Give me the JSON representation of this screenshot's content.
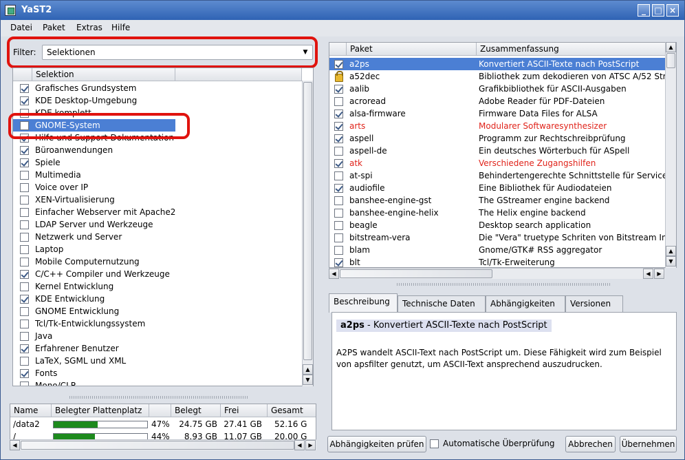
{
  "window": {
    "title": "YaST2",
    "minimize": "_",
    "maximize": "□",
    "close": "×"
  },
  "menu": [
    "Datei",
    "Paket",
    "Extras",
    "Hilfe"
  ],
  "filter": {
    "label": "Filter:",
    "value": "Selektionen"
  },
  "selection_list": {
    "header": "Selektion",
    "items": [
      {
        "label": "Grafisches Grundsystem",
        "checked": true
      },
      {
        "label": "KDE Desktop-Umgebung",
        "checked": true
      },
      {
        "label": "KDE komplett",
        "checked": false
      },
      {
        "label": "GNOME-System",
        "checked": false,
        "selected": true
      },
      {
        "label": "Hilfe und Support-Dokumentation",
        "checked": true
      },
      {
        "label": "Büroanwendungen",
        "checked": true
      },
      {
        "label": "Spiele",
        "checked": true
      },
      {
        "label": "Multimedia",
        "checked": false
      },
      {
        "label": "Voice over IP",
        "checked": false
      },
      {
        "label": "XEN-Virtualisierung",
        "checked": false
      },
      {
        "label": "Einfacher Webserver mit Apache2",
        "checked": false
      },
      {
        "label": "LDAP Server und Werkzeuge",
        "checked": false
      },
      {
        "label": "Netzwerk und Server",
        "checked": false
      },
      {
        "label": "Laptop",
        "checked": false
      },
      {
        "label": "Mobile Computernutzung",
        "checked": false
      },
      {
        "label": "C/C++ Compiler und Werkzeuge",
        "checked": true
      },
      {
        "label": "Kernel Entwicklung",
        "checked": false
      },
      {
        "label": "KDE Entwicklung",
        "checked": true
      },
      {
        "label": "GNOME Entwicklung",
        "checked": false
      },
      {
        "label": "Tcl/Tk-Entwicklungssystem",
        "checked": false
      },
      {
        "label": "Java",
        "checked": false
      },
      {
        "label": "Erfahrener Benutzer",
        "checked": true
      },
      {
        "label": "LaTeX, SGML und XML",
        "checked": false
      },
      {
        "label": "Fonts",
        "checked": true
      },
      {
        "label": "Mono/CLR",
        "checked": false
      }
    ]
  },
  "disk": {
    "headers": [
      "Name",
      "Belegter Plattenplatz",
      "",
      "Belegt",
      "Frei",
      "Gesamt"
    ],
    "rows": [
      {
        "name": "/data2",
        "percent_text": "47%",
        "fill": 0.47,
        "used": "24.75 GB",
        "free": "27.41 GB",
        "total": "52.16 G"
      },
      {
        "name": "/",
        "percent_text": "44%",
        "fill": 0.44,
        "used": "8.93 GB",
        "free": "11.07 GB",
        "total": "20.00 G"
      }
    ]
  },
  "package_list": {
    "headers": [
      "Paket",
      "Zusammenfassung"
    ],
    "items": [
      {
        "name": "a2ps",
        "summary": "Konvertiert ASCII-Texte nach PostScript",
        "state": "checked",
        "selected": true
      },
      {
        "name": "a52dec",
        "summary": "Bibliothek zum dekodieren von ATSC A/52 Str",
        "state": "locked"
      },
      {
        "name": "aalib",
        "summary": "Grafikbibliothek für ASCII-Ausgaben",
        "state": "checked"
      },
      {
        "name": "acroread",
        "summary": "Adobe Reader für PDF-Dateien",
        "state": "unchecked"
      },
      {
        "name": "alsa-firmware",
        "summary": "Firmware Data Files for ALSA",
        "state": "checked"
      },
      {
        "name": "arts",
        "summary": "Modularer Softwaresynthesizer",
        "state": "checked",
        "red": true
      },
      {
        "name": "aspell",
        "summary": "Programm zur Rechtschreibprüfung",
        "state": "checked"
      },
      {
        "name": "aspell-de",
        "summary": "Ein deutsches Wörterbuch für ASpell",
        "state": "unchecked"
      },
      {
        "name": "atk",
        "summary": "Verschiedene Zugangshilfen",
        "state": "checked",
        "red": true
      },
      {
        "name": "at-spi",
        "summary": "Behindertengerechte Schnittstelle für Service",
        "state": "unchecked"
      },
      {
        "name": "audiofile",
        "summary": "Eine Bibliothek für Audiodateien",
        "state": "checked"
      },
      {
        "name": "banshee-engine-gst",
        "summary": "The GStreamer engine backend",
        "state": "unchecked"
      },
      {
        "name": "banshee-engine-helix",
        "summary": "The Helix engine backend",
        "state": "unchecked"
      },
      {
        "name": "beagle",
        "summary": "Desktop search application",
        "state": "unchecked"
      },
      {
        "name": "bitstream-vera",
        "summary": "Die \"Vera\" truetype Schriten von Bitstream Inc",
        "state": "unchecked"
      },
      {
        "name": "blam",
        "summary": "Gnome/GTK# RSS aggregator",
        "state": "unchecked"
      },
      {
        "name": "blt",
        "summary": "Tcl/Tk-Erweiterung",
        "state": "checked"
      }
    ]
  },
  "tabs": [
    "Beschreibung",
    "Technische Daten",
    "Abhängigkeiten",
    "Versionen"
  ],
  "description": {
    "name": "a2ps",
    "headline_suffix": " - Konvertiert ASCII-Texte nach PostScript",
    "body": "A2PS wandelt ASCII-Text nach PostScript um. Diese Fähigkeit wird zum Beispiel von apsfilter genutzt, um ASCII-Text ansprechend auszudrucken."
  },
  "buttons": {
    "check_deps": "Abhängigkeiten prüfen",
    "auto_check": "Automatische Überprüfung",
    "cancel": "Abbrechen",
    "accept": "Übernehmen"
  },
  "colors": {
    "selection": "#4b7fd4",
    "highlight_marker": "#e0130e",
    "warning_text": "#e0231a"
  }
}
